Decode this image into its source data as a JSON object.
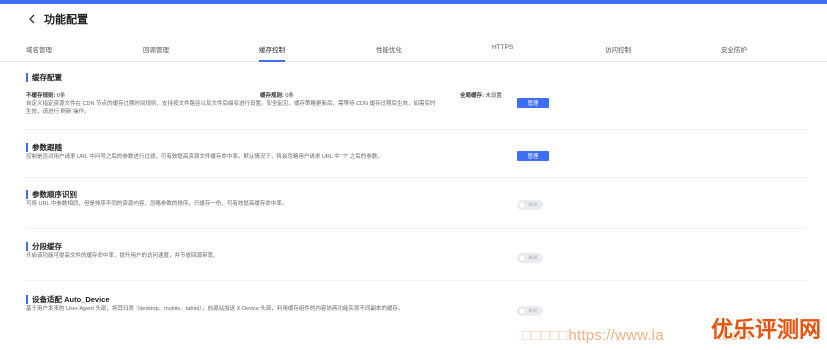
{
  "header": {
    "title": "功能配置"
  },
  "tabs": [
    {
      "label": "域名管理"
    },
    {
      "label": "回源管理"
    },
    {
      "label": "缓存控制"
    },
    {
      "label": "性能优化"
    },
    {
      "label": "HTTPS"
    },
    {
      "label": "访问控制"
    },
    {
      "label": "安全防护"
    }
  ],
  "active_tab": "缓存控制",
  "accent_color": "#3d6ef5",
  "sections": {
    "cache_config": {
      "title": "缓存配置",
      "kv": [
        {
          "key": "不缓存规则:",
          "value": "0条"
        },
        {
          "key": "缓存规则:",
          "value": "0条"
        },
        {
          "key": "全局缓存:",
          "value": "未设置"
        }
      ],
      "desc_line1": "自定义指定资源文件在 CDN 节点的缓存过期时间规则，支持按文件路径以及文件后缀名进行设置。安全起见，缓存策略更新后，需等待 CDN 缓存过期后生效，如需实时",
      "desc_line2": "生效，请进行 刷新 操作。",
      "button": "管理"
    },
    "param_follow": {
      "title": "参数跟随",
      "desc": "控制是否对用户请求 URL 中问号之后的参数进行过滤，可有效提高资源文件缓存命中率。默认情况下，将会忽略用户请求 URL 中 \"?\" 之后的参数。",
      "button": "管理"
    },
    "param_order": {
      "title": "参数顺序识别",
      "desc": "可将 URL 中参数相同，但是排序不同的资源内容，忽略参数的排序，只缓存一份，可有效提高缓存命中率。",
      "toggle": "关闭"
    },
    "segment_cache": {
      "title": "分段缓存",
      "desc": "开启该功能可提高文件的缓存命中率，提升用户的访问速度，并节省回源带宽。",
      "toggle": "关闭"
    },
    "device_adapt": {
      "title": "设备适配 Auto_Device",
      "desc": "基于用户发来的 User-Agent 头部，将其归类（desktop、mobile、tablet），向源站加送 X-Device 头部，利用缓存组件的内容协商功能实现不同副本的缓存。",
      "toggle": "关闭"
    }
  },
  "watermark": {
    "url_prefix": "https://www.la",
    "url_suffix": ".com",
    "brand": "优乐评测网"
  }
}
